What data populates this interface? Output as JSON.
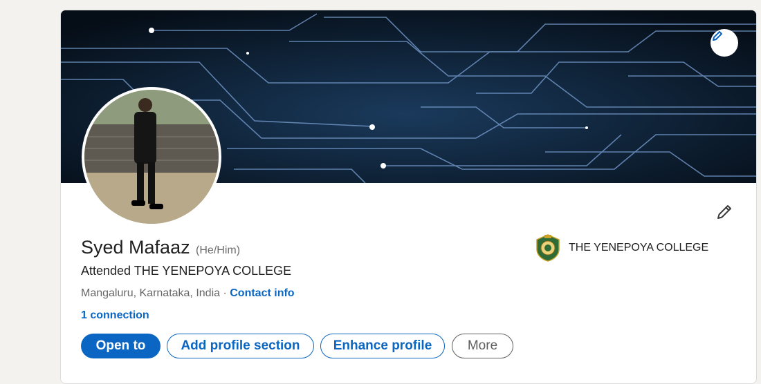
{
  "colors": {
    "accent": "#0a66c2",
    "page_bg": "#f4f2ee",
    "banner_bg": "#06111c"
  },
  "profile": {
    "name": "Syed Mafaaz",
    "pronouns": "(He/Him)",
    "headline": "Attended THE YENEPOYA COLLEGE",
    "location": "Mangaluru, Karnataka, India",
    "separator": "·",
    "contact_info": "Contact info",
    "connections": "1 connection"
  },
  "education": {
    "school_name": "THE YENEPOYA COLLEGE",
    "logo_icon": "college-crest-icon"
  },
  "actions": {
    "open_to": "Open to",
    "add_section": "Add profile section",
    "enhance": "Enhance profile",
    "more": "More"
  },
  "icons": {
    "banner_edit": "pencil-icon",
    "intro_edit": "pencil-icon"
  }
}
